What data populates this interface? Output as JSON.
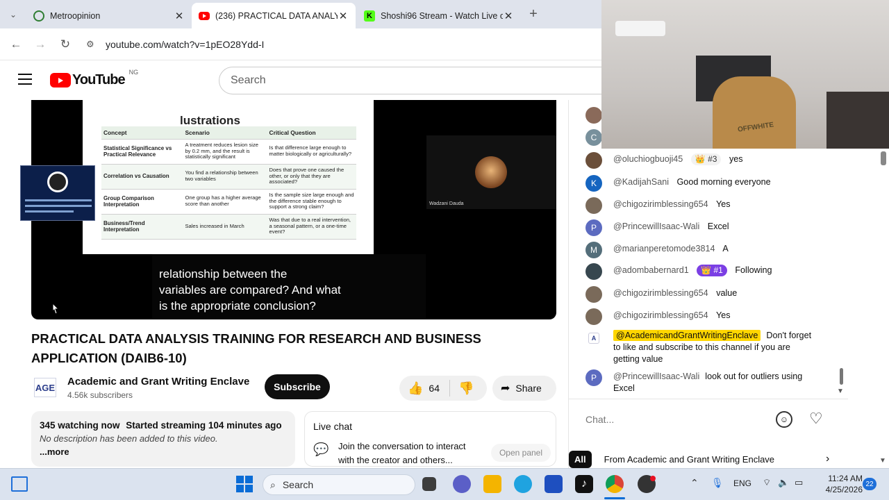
{
  "browser": {
    "tabs": [
      {
        "title": "Metroopinion",
        "close": "✕"
      },
      {
        "title": "(236) PRACTICAL DATA ANALYS",
        "close": "✕"
      },
      {
        "title": "Shoshi96 Stream - Watch Live o",
        "close": "✕"
      }
    ],
    "new_tab": "+",
    "url": "youtube.com/watch?v=1pEO28Ydd-I"
  },
  "youtube": {
    "logo_text": "YouTube",
    "region": "NG",
    "search_placeholder": "Search"
  },
  "slide": {
    "title": "lustrations",
    "headers": [
      "Concept",
      "Scenario",
      "Critical Question"
    ],
    "rows": [
      [
        "Statistical Significance vs Practical Relevance",
        "A treatment reduces lesion size by 0.2 mm, and the result is statistically significant",
        "Is that difference large enough to matter biologically or agriculturally?"
      ],
      [
        "Correlation vs Causation",
        "You find a relationship between two variables",
        "Does that prove one caused the other, or only that they are associated?"
      ],
      [
        "Group Comparison Interpretation",
        "One group has a higher average score than another",
        "Is the sample size large enough and the difference stable enough to support a strong claim?"
      ],
      [
        "Business/Trend Interpretation",
        "Sales increased in March",
        "Was that due to a real intervention, a seasonal pattern, or a one-time event?"
      ]
    ],
    "participant_name": "Wadzani Dauda"
  },
  "captions": [
    "relationship between the",
    "variables are compared? And what",
    "is the appropriate conclusion?"
  ],
  "video": {
    "title": "PRACTICAL DATA ANALYSIS TRAINING FOR RESEARCH AND BUSINESS APPLICATION (DAIB6-10)",
    "channel_name": "Academic and Grant Writing Enclave",
    "channel_logo_text": "AGE",
    "subscribers": "4.56k subscribers",
    "subscribe_label": "Subscribe",
    "likes": "64",
    "share_label": "Share",
    "watching": "345 watching now",
    "started": "Started streaming 104 minutes ago",
    "description": "No description has been added to this video.",
    "more": "...more"
  },
  "live_chat_card": {
    "title": "Live chat",
    "text_line1": "Join the conversation to interact",
    "text_line2": "with the creator and others...",
    "open_panel": "Open panel"
  },
  "chat": {
    "top_avatar_letter": "C",
    "messages": [
      {
        "author": "@oluchiogbuoji45",
        "badge": "#3",
        "text": "yes",
        "avatar": "",
        "color": "#6b4f3a"
      },
      {
        "author": "@KadijahSani",
        "badge": "",
        "text": "Good morning everyone",
        "avatar": "K",
        "color": "#1565c0"
      },
      {
        "author": "@chigozirimblessing654",
        "badge": "",
        "text": "Yes",
        "avatar": "",
        "color": "#7a6a5a"
      },
      {
        "author": "@PrincewillIsaac-Wali",
        "badge": "",
        "text": "Excel",
        "avatar": "P",
        "color": "#5c6bc0"
      },
      {
        "author": "@marianperetomode3814",
        "badge": "",
        "text": "A",
        "avatar": "M",
        "color": "#546e7a"
      },
      {
        "author": "@adombabernard1",
        "badge": "#1",
        "text": "Following",
        "avatar": "",
        "color": "#37474f"
      },
      {
        "author": "@chigozirimblessing654",
        "badge": "",
        "text": "value",
        "avatar": "",
        "color": "#7a6a5a"
      },
      {
        "author": "@chigozirimblessing654",
        "badge": "",
        "text": "Yes",
        "avatar": "",
        "color": "#7a6a5a"
      }
    ],
    "owner_message": {
      "author": "@AcademicandGrantWritingEnclave",
      "line1": "Don't forget",
      "line2": "to like and subscribe to this channel if you are",
      "line3": "getting value"
    },
    "last_message": {
      "author": "@PrincewillIsaac-Wali",
      "line1": "look out for outliers using",
      "line2": "Excel",
      "avatar": "P"
    },
    "input_placeholder": "Chat...",
    "filter_all": "All",
    "filter_from": "From Academic and Grant Writing Enclave"
  },
  "webcam": {
    "shirt_text": "OFFWHITE"
  },
  "taskbar": {
    "search": "Search",
    "lang": "ENG",
    "time": "11:24 AM",
    "date": "4/25/2026",
    "notification_count": "22"
  }
}
